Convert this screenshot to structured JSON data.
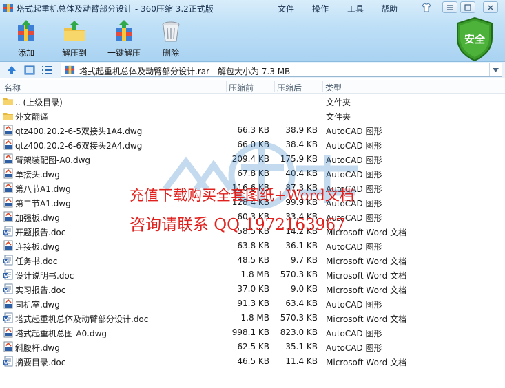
{
  "window": {
    "title": "塔式起重机总体及动臂部分设计 - 360压缩 3.2正式版",
    "menu": [
      "文件",
      "操作",
      "工具",
      "帮助"
    ]
  },
  "toolbar": {
    "add": "添加",
    "extract": "解压到",
    "one_click": "一键解压",
    "delete": "删除",
    "safety": "安全"
  },
  "address": {
    "path": "塔式起重机总体及动臂部分设计.rar - 解包大小为 7.3 MB"
  },
  "columns": {
    "name": "名称",
    "compressed": "压缩前",
    "original": "压缩后",
    "type": "类型"
  },
  "files": [
    {
      "name": ".. (上级目录)",
      "csize": "",
      "osize": "",
      "type": "文件夹",
      "icon": "folder-icon"
    },
    {
      "name": "外文翻译",
      "csize": "",
      "osize": "",
      "type": "文件夹",
      "icon": "folder-icon"
    },
    {
      "name": "qtz400.20.2-6-5双接头1A4.dwg",
      "csize": "66.3 KB",
      "osize": "38.9 KB",
      "type": "AutoCAD 图形",
      "icon": "dwg-icon"
    },
    {
      "name": "qtz400.20.2-6-6双接头2A4.dwg",
      "csize": "66.0 KB",
      "osize": "38.4 KB",
      "type": "AutoCAD 图形",
      "icon": "dwg-icon"
    },
    {
      "name": "臂架装配图-A0.dwg",
      "csize": "209.4 KB",
      "osize": "175.9 KB",
      "type": "AutoCAD 图形",
      "icon": "dwg-icon"
    },
    {
      "name": "单接头.dwg",
      "csize": "67.8 KB",
      "osize": "40.4 KB",
      "type": "AutoCAD 图形",
      "icon": "dwg-icon"
    },
    {
      "name": "第八节A1.dwg",
      "csize": "116.6 KB",
      "osize": "87.3 KB",
      "type": "AutoCAD 图形",
      "icon": "dwg-icon"
    },
    {
      "name": "第二节A1.dwg",
      "csize": "128.4 KB",
      "osize": "99.9 KB",
      "type": "AutoCAD 图形",
      "icon": "dwg-icon"
    },
    {
      "name": "加强板.dwg",
      "csize": "60.3 KB",
      "osize": "33.4 KB",
      "type": "AutoCAD 图形",
      "icon": "dwg-icon"
    },
    {
      "name": "开题报告.doc",
      "csize": "58.5 KB",
      "osize": "14.2 KB",
      "type": "Microsoft Word 文档",
      "icon": "doc-icon"
    },
    {
      "name": "连接板.dwg",
      "csize": "63.8 KB",
      "osize": "36.1 KB",
      "type": "AutoCAD 图形",
      "icon": "dwg-icon"
    },
    {
      "name": "任务书.doc",
      "csize": "48.5 KB",
      "osize": "9.7 KB",
      "type": "Microsoft Word 文档",
      "icon": "doc-icon"
    },
    {
      "name": "设计说明书.doc",
      "csize": "1.8 MB",
      "osize": "570.3 KB",
      "type": "Microsoft Word 文档",
      "icon": "doc-icon"
    },
    {
      "name": "实习报告.doc",
      "csize": "37.0 KB",
      "osize": "9.0 KB",
      "type": "Microsoft Word 文档",
      "icon": "doc-icon"
    },
    {
      "name": "司机室.dwg",
      "csize": "91.3 KB",
      "osize": "63.4 KB",
      "type": "AutoCAD 图形",
      "icon": "dwg-icon"
    },
    {
      "name": "塔式起重机总体及动臂部分设计.doc",
      "csize": "1.8 MB",
      "osize": "570.3 KB",
      "type": "Microsoft Word 文档",
      "icon": "doc-icon"
    },
    {
      "name": "塔式起重机总图-A0.dwg",
      "csize": "998.1 KB",
      "osize": "823.0 KB",
      "type": "AutoCAD 图形",
      "icon": "dwg-icon"
    },
    {
      "name": "斜腹杆.dwg",
      "csize": "62.5 KB",
      "osize": "35.1 KB",
      "type": "AutoCAD 图形",
      "icon": "dwg-icon"
    },
    {
      "name": "摘要目录.doc",
      "csize": "46.5 KB",
      "osize": "11.4 KB",
      "type": "Microsoft Word 文档",
      "icon": "doc-icon"
    }
  ],
  "watermark": {
    "line1": "充值下载购买全套图纸+Word文档",
    "line2": "咨询请联系 QQ 1972163967"
  },
  "colors": {
    "header_bg": "#bfe0f7",
    "watermark_red": "#e0201c",
    "shield_green": "#3a9a2a"
  }
}
